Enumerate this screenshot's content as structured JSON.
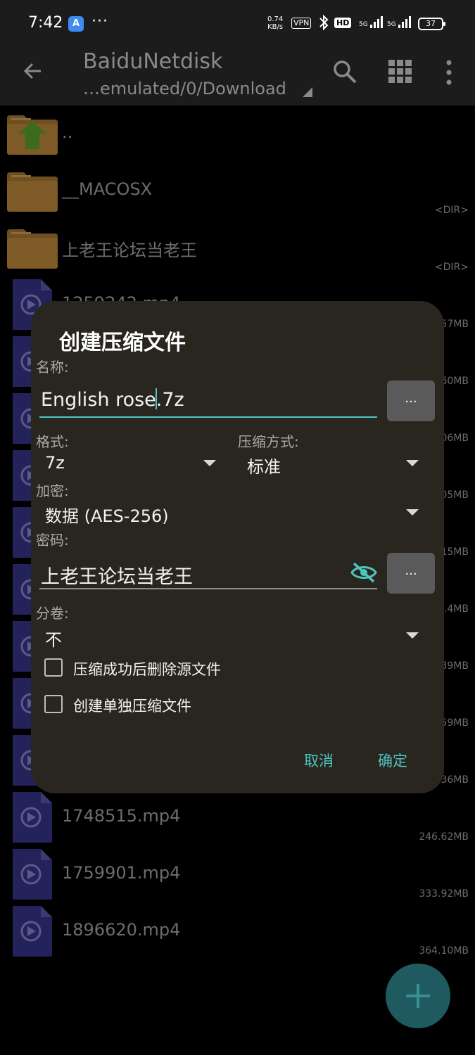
{
  "status_bar": {
    "time": "7:42",
    "app_icon_text": "A",
    "dots": "···",
    "net_speed_value": "0.74",
    "net_speed_unit": "KB/s",
    "vpn": "VPN",
    "hd": "HD",
    "signal_1": "5G",
    "signal_2": "5G",
    "battery": "37"
  },
  "app_bar": {
    "title": "BaiduNetdisk",
    "path": "…emulated/0/Download"
  },
  "files": [
    {
      "name": "..",
      "meta": "",
      "type": "parent"
    },
    {
      "name": "__MACOSX",
      "meta": "<DIR>",
      "type": "folder"
    },
    {
      "name": "上老王论坛当老王",
      "meta": "<DIR>",
      "type": "folder"
    },
    {
      "name": "1259242.mp4",
      "meta": "...57MB",
      "type": "video"
    },
    {
      "name": "",
      "meta": "...60MB",
      "type": "video"
    },
    {
      "name": "",
      "meta": "...06MB",
      "type": "video"
    },
    {
      "name": "",
      "meta": "...05MB",
      "type": "video"
    },
    {
      "name": "",
      "meta": "...15MB",
      "type": "video"
    },
    {
      "name": "",
      "meta": "...4MB",
      "type": "video"
    },
    {
      "name": "",
      "meta": "...39MB",
      "type": "video"
    },
    {
      "name": "",
      "meta": "...59MB",
      "type": "video"
    },
    {
      "name": "",
      "meta": "...36MB",
      "type": "video"
    },
    {
      "name": "1748515.mp4",
      "meta": "246.62MB",
      "type": "video"
    },
    {
      "name": "1759901.mp4",
      "meta": "333.92MB",
      "type": "video"
    },
    {
      "name": "1896620.mp4",
      "meta": "364.10MB",
      "type": "video"
    }
  ],
  "dialog": {
    "title": "创建压缩文件",
    "name_label": "名称:",
    "name_value_before": "English rose",
    "name_value_after": ".7z",
    "browse_label": "...",
    "format_label": "格式:",
    "format_value": "7z",
    "method_label": "压缩方式:",
    "method_value": "标准",
    "encrypt_label": "加密:",
    "encrypt_value": "数据 (AES-256)",
    "password_label": "密码:",
    "password_value": "上老王论坛当老王",
    "password_browse_label": "...",
    "split_label": "分卷:",
    "split_value": "不",
    "delete_source_label": "压缩成功后删除源文件",
    "separate_archives_label": "创建单独压缩文件",
    "cancel_label": "取消",
    "ok_label": "确定"
  },
  "colors": {
    "accent": "#4dc6c0",
    "dialog_bg": "#29261f",
    "folder": "#7a5a2a",
    "video": "#2b2a66"
  }
}
